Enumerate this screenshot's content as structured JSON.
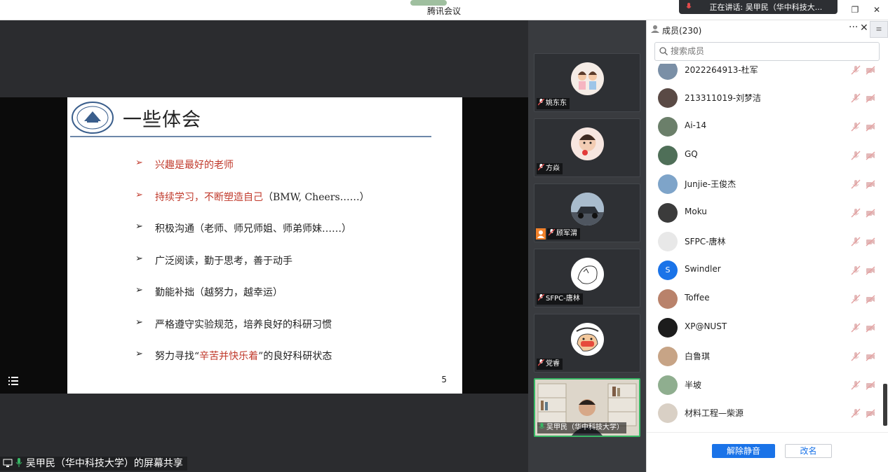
{
  "window": {
    "title": "腾讯会议",
    "speaking_label": "正在讲话: 吴甲民（华中科技大..."
  },
  "slide": {
    "title": "一些体会",
    "bullets": [
      {
        "text": "兴趣是最好的老师",
        "style": "red"
      },
      {
        "text": "持续学习，不断塑造自己",
        "suffix": "（BMW, Cheers……）",
        "style": "red-prefix"
      },
      {
        "text": "积极沟通（老师、师兄师姐、师弟师妹……）",
        "style": "normal"
      },
      {
        "text": "广泛阅读，勤于思考，善于动手",
        "style": "normal"
      },
      {
        "text": "勤能补拙（越努力，越幸运）",
        "style": "normal"
      },
      {
        "text": "严格遵守实验规范，培养良好的科研习惯",
        "style": "normal"
      },
      {
        "text_before": "努力寻找“",
        "highlight": "辛苦并快乐着",
        "text_after": "”的良好科研状态",
        "style": "mixed"
      }
    ],
    "page_number": "5"
  },
  "share_label": "吴甲民（华中科技大学）的屏幕共享",
  "video_tiles": [
    {
      "name": "姚东东",
      "avatar": "kids-avatar"
    },
    {
      "name": "方焱",
      "avatar": "baby-avatar"
    },
    {
      "name": "顾军渭",
      "avatar": "car-avatar",
      "host": true
    },
    {
      "name": "SFPC-唐林",
      "avatar": "sketch-avatar"
    },
    {
      "name": "党睿",
      "avatar": "power-cartoon-avatar"
    },
    {
      "name": "吴甲民（华中科技大学）",
      "avatar": "live-video",
      "active": true
    }
  ],
  "members_panel": {
    "title": "成员(230)",
    "search_placeholder": "搜索成员",
    "members": [
      {
        "name": "2022264913-杜军",
        "color": "#7a8fa6"
      },
      {
        "name": "213311019-刘梦洁",
        "color": "#5a4a45"
      },
      {
        "name": "Ai-14",
        "color": "#6b7f6a"
      },
      {
        "name": "GQ",
        "color": "#4f6f58"
      },
      {
        "name": "Junjie-王俊杰",
        "color": "#7ea4c9"
      },
      {
        "name": "Moku",
        "color": "#3b3b3b"
      },
      {
        "name": "SFPC-唐林",
        "color": "#e8e8e8"
      },
      {
        "name": "Swindler",
        "color": "#1a73e8",
        "initial": "S"
      },
      {
        "name": "Toffee",
        "color": "#b9826b"
      },
      {
        "name": "XP@NUST",
        "color": "#1c1c1c"
      },
      {
        "name": "白鲁琪",
        "color": "#c7a486"
      },
      {
        "name": "半坡",
        "color": "#8fae8f"
      },
      {
        "name": "材料工程—柴源",
        "color": "#d9d0c5"
      }
    ],
    "unmute_label": "解除静音",
    "rename_label": "改名"
  },
  "colors": {
    "accent": "#1a73e8",
    "active_border": "#37b865",
    "slide_red": "#c0392b"
  }
}
